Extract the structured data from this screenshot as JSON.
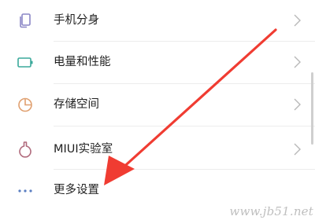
{
  "settings": {
    "items": [
      {
        "label": "手机分身",
        "icon": "dual-apps-icon",
        "icon_color": "#8a86c6"
      },
      {
        "label": "电量和性能",
        "icon": "battery-icon",
        "icon_color": "#3aa99b"
      },
      {
        "label": "存储空间",
        "icon": "storage-pie-icon",
        "icon_color": "#e0a070"
      },
      {
        "label": "MIUI实验室",
        "icon": "lab-flask-icon",
        "icon_color": "#b06a7c"
      },
      {
        "label": "更多设置",
        "icon": "more-dots-icon",
        "icon_color": "#5b7fc2"
      }
    ]
  },
  "annotation": {
    "arrow_color": "#f03c32"
  },
  "watermark": {
    "text": "www.jb51.net"
  }
}
